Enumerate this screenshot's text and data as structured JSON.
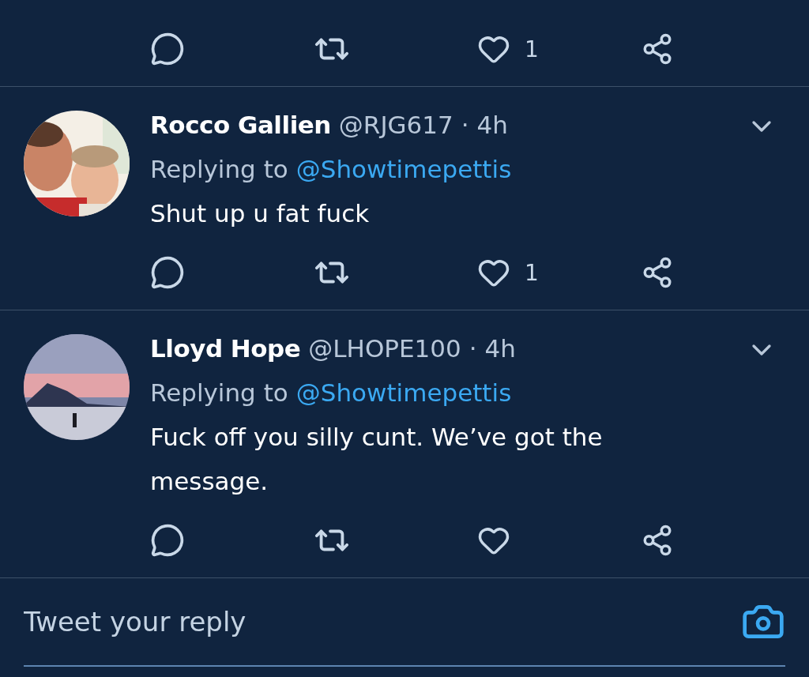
{
  "partial_tweet": {
    "actions": {
      "likes": "1"
    }
  },
  "tweets": [
    {
      "name": "Rocco Gallien",
      "handle": "@RJG617",
      "time": "· 4h",
      "replying_label": "Replying to",
      "replying_to": "@Showtimepettis",
      "text": "Shut up u fat fuck",
      "actions": {
        "likes": "1"
      }
    },
    {
      "name": "Lloyd Hope",
      "handle": "@LHOPE100",
      "time": "· 4h",
      "replying_label": "Replying to",
      "replying_to": "@Showtimepettis",
      "text": "Fuck off you silly cunt. We’ve got the message."
    }
  ],
  "reply_bar": {
    "placeholder": "Tweet your reply"
  }
}
